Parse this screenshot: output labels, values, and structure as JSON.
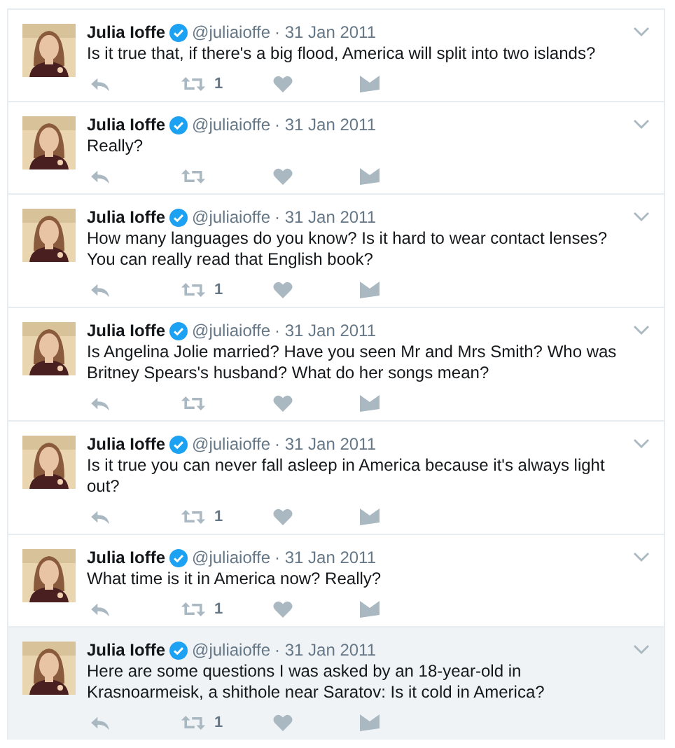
{
  "tweets": [
    {
      "name": "Julia Ioffe",
      "verified": true,
      "handle": "@juliaioffe",
      "date": "· 31 Jan 2011",
      "text": "Is it true that, if there's a big flood, America will split into two islands?",
      "retweets": "1",
      "highlighted": false
    },
    {
      "name": "Julia Ioffe",
      "verified": true,
      "handle": "@juliaioffe",
      "date": "· 31 Jan 2011",
      "text": "Really?",
      "highlighted": false
    },
    {
      "name": "Julia Ioffe",
      "verified": true,
      "handle": "@juliaioffe",
      "date": "· 31 Jan 2011",
      "text": "How many languages do you know? Is it hard to wear contact lenses? You can really read that English book?",
      "retweets": "1",
      "highlighted": false
    },
    {
      "name": "Julia Ioffe",
      "verified": true,
      "handle": "@juliaioffe",
      "date": "· 31 Jan 2011",
      "text": "Is Angelina Jolie married? Have you seen Mr and Mrs Smith? Who was Britney Spears's husband? What do her songs mean?",
      "highlighted": false
    },
    {
      "name": "Julia Ioffe",
      "verified": true,
      "handle": "@juliaioffe",
      "date": "· 31 Jan 2011",
      "text": "Is it true you can never fall asleep in America because it's always light out?",
      "retweets": "1",
      "highlighted": false
    },
    {
      "name": "Julia Ioffe",
      "verified": true,
      "handle": "@juliaioffe",
      "date": "· 31 Jan 2011",
      "text": "What time is it in America now? Really?",
      "retweets": "1",
      "highlighted": false
    },
    {
      "name": "Julia Ioffe",
      "verified": true,
      "handle": "@juliaioffe",
      "date": "· 31 Jan 2011",
      "text": "Here are some questions I was asked by an 18-year-old in Krasnoarmeisk, a shithole near Saratov: Is it cold in America?",
      "retweets": "1",
      "highlighted": true
    }
  ]
}
